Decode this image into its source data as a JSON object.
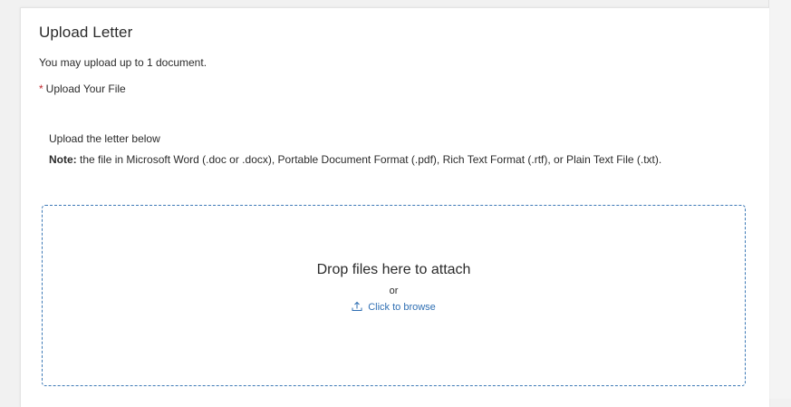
{
  "upload": {
    "title": "Upload Letter",
    "limit_text": "You may upload up to 1 document.",
    "required_marker": "*",
    "field_label": "Upload Your File",
    "instruction": "Upload the letter below",
    "note_prefix": "Note:",
    "note_text": " the file in Microsoft Word (.doc or .docx), Portable Document Format (.pdf), Rich Text Format (.rtf), or Plain Text File (.txt).",
    "dropzone": {
      "title": "Drop files here to attach",
      "or_text": "or",
      "browse_label": "Click to browse",
      "browse_icon": "upload-icon"
    }
  },
  "colors": {
    "required_marker": "#c1272d",
    "dropzone_border": "#3d79b6",
    "link": "#2f6fb3"
  }
}
